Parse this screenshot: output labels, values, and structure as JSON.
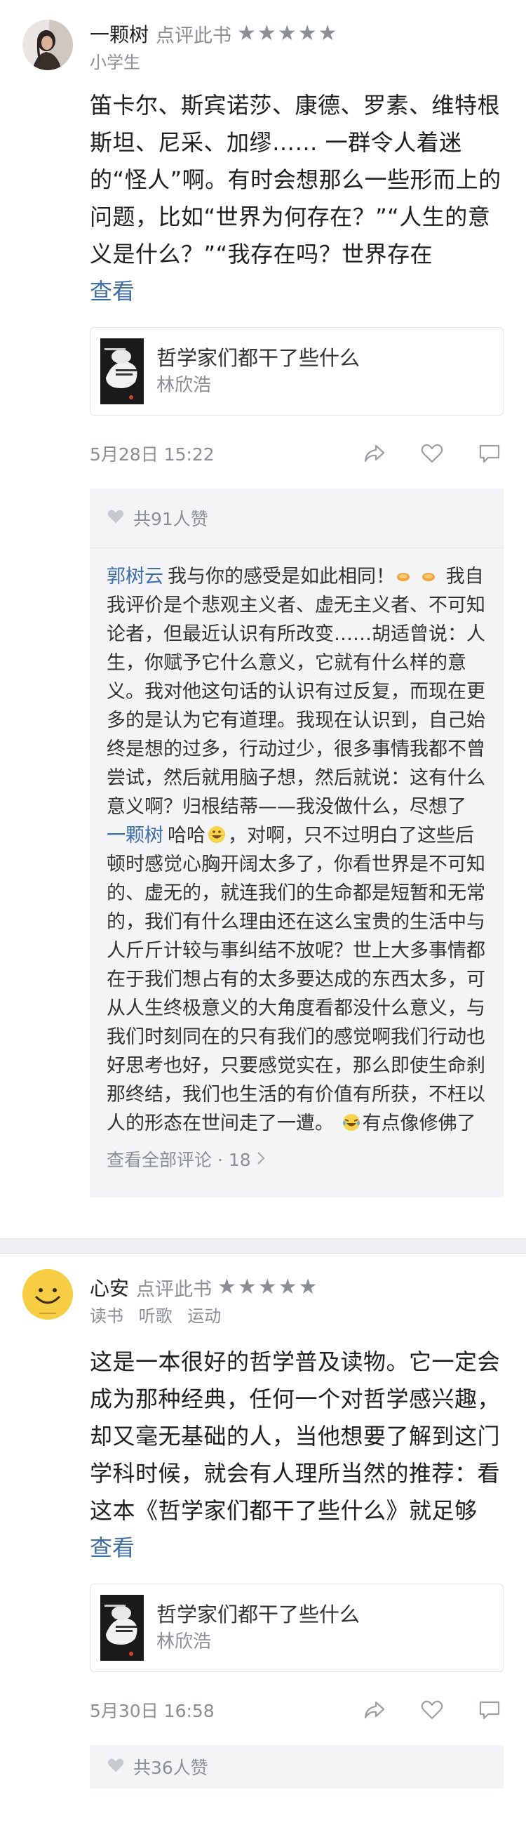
{
  "reviews": [
    {
      "username": "一颗树",
      "action": "点评此书",
      "rating": 5,
      "tags": [
        "小学生"
      ],
      "text": "笛卡尔、斯宾诺莎、康德、罗素、维特根斯坦、尼采、加缪…… 一群令人着迷的“怪人”啊。有时会想那么一些形而上的问题，比如“世界为何存在？”“人生的意义是什么？”“我存在吗？世界存在吗？”“有什么知识或信条可以贯彻人…",
      "more_label": "查看",
      "book": {
        "title": "哲学家们都干了些什么",
        "author": "林欣浩"
      },
      "date": "5月28日 15:22",
      "likes": "共91人赞",
      "comments": [
        {
          "user": "郭树云",
          "text_a": "我与你的感受是如此相同！",
          "text_b": "我自我评价是个悲观主义者、虚无主义者、不可知论者，但最近认识有所改变……胡适曾说：人生，你赋予它什么意义，它就有什么样的意义。我对他这句话的认识有过反复，而现在更多的是认为它有道理。我现在认识到，自己始终是想的过多，行动过少，很多事情我都不曾尝试，然后就用脑子想，然后就说：这有什么意义啊？归根结蒂——我没做什么，尽想了"
        },
        {
          "user": "一颗树",
          "text_a": "哈哈",
          "text_b": "，对啊，只不过明白了这些后顿时感觉心胸开阔太多了，你看世界是不可知的、虚无的，就连我们的生命都是短暂和无常的，我们有什么理由还在这么宝贵的生活中与人斤斤计较与事纠结不放呢？世上大多事情都在于我们想占有的太多要达成的东西太多，可从人生终极意义的大角度看都没什么意义，与我们时刻同在的只有我们的感觉啊我们行动也好思考也好，只要感觉实在，那么即使生命刹那终结，我们也生活的有价值有所获，不枉以人的形态在世间走了一遭。",
          "text_c": "有点像修佛了是吧……"
        }
      ],
      "view_all": "查看全部评论 · 18"
    },
    {
      "username": "心安",
      "action": "点评此书",
      "rating": 5,
      "tags": [
        "读书",
        "听歌",
        "运动"
      ],
      "text": "这是一本很好的哲学普及读物。它一定会成为那种经典，任何一个对哲学感兴趣，却又毫无基础的人，当他想要了解到这门学科时候，就会有人理所当然的推荐：看这本《哲学家们都干了些什么》就足够了。我也是受书友的推荐…",
      "more_label": "查看",
      "book": {
        "title": "哲学家们都干了些什么",
        "author": "林欣浩"
      },
      "date": "5月30日 16:58",
      "likes": "共36人赞"
    }
  ],
  "colors": {
    "link": "#3f6fa8",
    "meta": "#8a8f95",
    "text": "#1f1f1f",
    "panel": "#f3f4f6"
  }
}
